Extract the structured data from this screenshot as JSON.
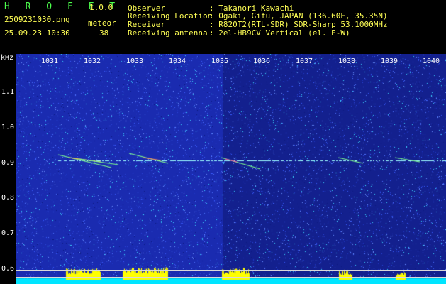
{
  "header": {
    "app_name": "H R O F F T",
    "version": "1.0.0",
    "filename": "2509231030.png",
    "datetime": "25.09.23 10:30",
    "meteor_label": "meteor",
    "meteor_count": "38",
    "fields": [
      {
        "label": "Observer",
        "value": ": Takanori Kawachi"
      },
      {
        "label": "Receiving Location",
        "value": ": Ogaki, Gifu, JAPAN (136.60E, 35.35N)"
      },
      {
        "label": "Receiver",
        "value": ": R820T2(RTL-SDR) SDR-Sharp 53.1000MHz"
      },
      {
        "label": "Receiving antenna",
        "value": ": 2el-HB9CV Vertical (el. E-W)"
      }
    ]
  },
  "axis": {
    "unit": "kHz",
    "time_ticks": [
      "1031",
      "1032",
      "1033",
      "1034",
      "1035",
      "1036",
      "1037",
      "1038",
      "1039",
      "1040"
    ],
    "freq_ticks": [
      "1.1",
      "1.0",
      "0.9",
      "0.8",
      "0.7",
      "0.6"
    ]
  },
  "colors": {
    "background": "#1a2bb0",
    "carrier": "#9fffff",
    "meteor": "#7fff8f",
    "level": "#ffff00",
    "baseline": "#00e5ff"
  }
}
